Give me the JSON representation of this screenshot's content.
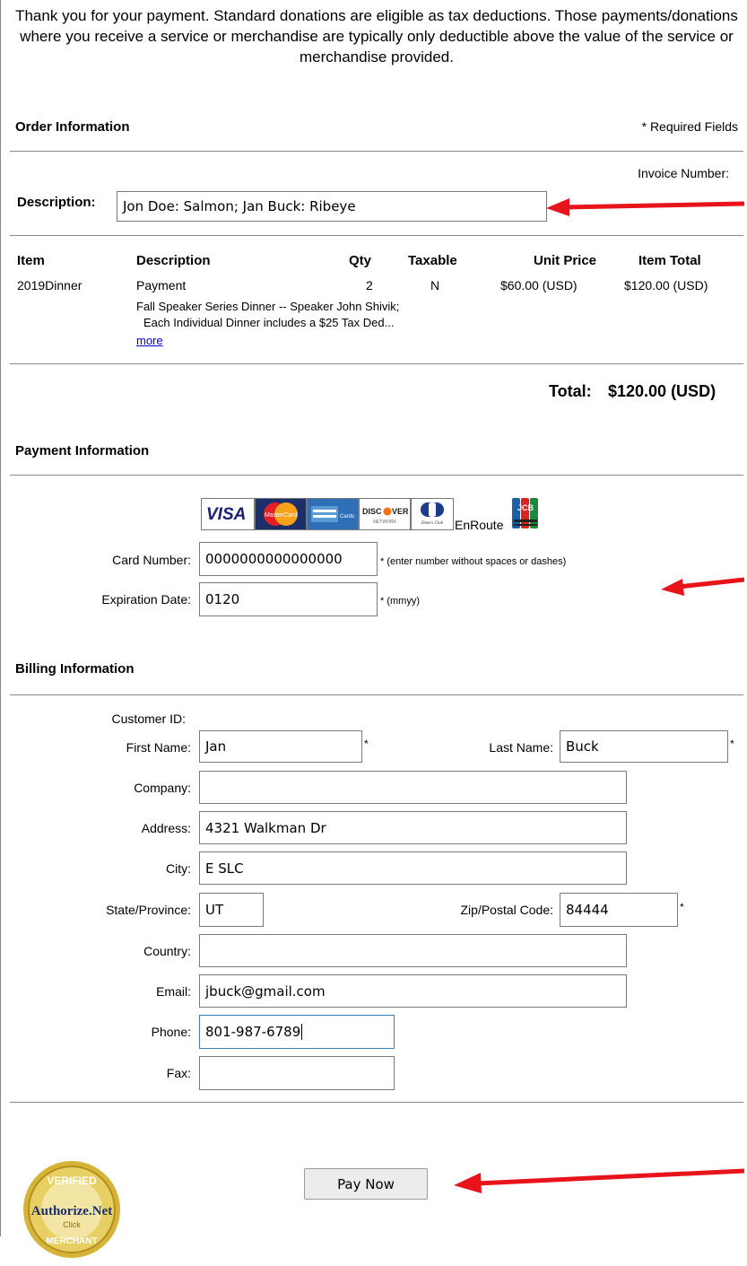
{
  "intro_text": "Thank you for your payment. Standard donations are eligible as tax deductions. Those payments/donations where you receive a service or merchandise are typically only deductible above the value of the service or merchandise provided.",
  "order": {
    "heading": "Order Information",
    "required_note": "* Required Fields",
    "invoice_label": "Invoice Number:",
    "description_label": "Description:",
    "description_value": "Jon Doe: Salmon; Jan Buck: Ribeye",
    "columns": [
      "Item",
      "Description",
      "Qty",
      "Taxable",
      "Unit Price",
      "Item Total"
    ],
    "row": {
      "item": "2019Dinner",
      "description": "Payment",
      "qty": "2",
      "taxable": "N",
      "unit_price": "$60.00 (USD)",
      "item_total": "$120.00 (USD)",
      "detail_line1": "Fall Speaker Series Dinner -- Speaker John Shivik;",
      "detail_line2": "Each Individual Dinner includes a $25 Tax Ded...",
      "more_link": "more"
    },
    "total_label": "Total:",
    "total_value": "$120.00 (USD)"
  },
  "payment": {
    "heading": "Payment Information",
    "card_logos": [
      "VISA",
      "MasterCard",
      "American Express",
      "DISCOVER",
      "Diners Club International",
      "EnRoute",
      "JCB"
    ],
    "enroute_label": "EnRoute",
    "card_number_label": "Card Number:",
    "card_number_value": "0000000000000000",
    "card_number_note": "* (enter number without spaces or dashes)",
    "exp_label": "Expiration Date:",
    "exp_value": "0120",
    "exp_note": "* (mmyy)"
  },
  "billing": {
    "heading": "Billing Information",
    "customer_id_label": "Customer ID:",
    "first_name_label": "First Name:",
    "first_name_value": "Jan",
    "last_name_label": "Last Name:",
    "last_name_value": "Buck",
    "company_label": "Company:",
    "company_value": "",
    "address_label": "Address:",
    "address_value": "4321 Walkman Dr",
    "city_label": "City:",
    "city_value": "E SLC",
    "state_label": "State/Province:",
    "state_value": "UT",
    "zip_label": "Zip/Postal Code:",
    "zip_value": "84444",
    "country_label": "Country:",
    "country_value": "",
    "email_label": "Email:",
    "email_value": "jbuck@gmail.com",
    "phone_label": "Phone:",
    "phone_value": "801-987-6789",
    "fax_label": "Fax:",
    "fax_value": "",
    "star": "*"
  },
  "seal": {
    "top_text": "VERIFIED",
    "brand": "Authorize.Net",
    "click": "Click",
    "bottom_text": "MERCHANT"
  },
  "pay_button": "Pay Now",
  "colors": {
    "arrow": "#e8141c",
    "link": "#0000cc",
    "seal_gold": "#c9a227",
    "seal_navy": "#1b2f6b"
  }
}
